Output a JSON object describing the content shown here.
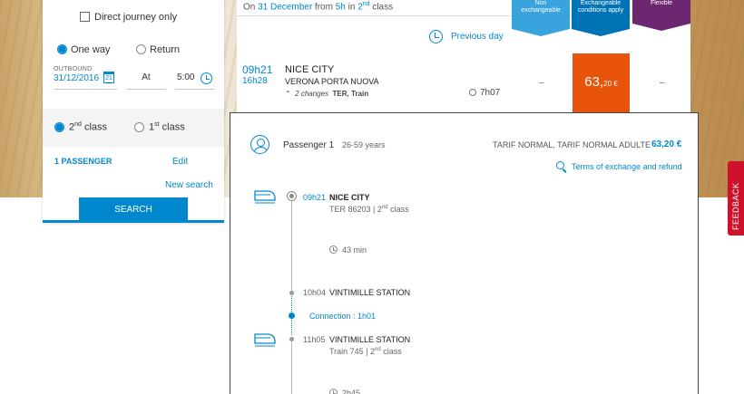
{
  "search": {
    "direct_journey": "Direct journey only",
    "one_way": "One way",
    "return": "Return",
    "outbound_label": "OUTBOUND",
    "outbound_date": "31/12/2016",
    "calendar_day": "21",
    "at_label": "At",
    "time_value": "5:00",
    "class2": "2",
    "class2_sup": "nd",
    "class2_suffix": " class",
    "class1": "1",
    "class1_sup": "st",
    "class1_suffix": " class",
    "passengers": "1 PASSENGER",
    "edit": "Edit",
    "new_search": "New search",
    "search_button": "SEARCH"
  },
  "results": {
    "header_prefix": "On ",
    "header_date": "31 December",
    "header_mid": " from ",
    "header_hour": "5h",
    "header_in": " in ",
    "header_class": "2",
    "header_class_sup": "nd",
    "header_suffix": " class",
    "fares": [
      {
        "line1": "Non",
        "line2": "exchangeable"
      },
      {
        "line1": "Exchangeable",
        "line2": "conditions apply"
      },
      {
        "line1": "Flexible",
        "line2": ""
      }
    ],
    "previous_day": "Previous day",
    "journey": {
      "dep_time": "09h21",
      "arr_time": "16h28",
      "dep_station": "NICE CITY",
      "arr_station": "VERONA PORTA NUOVA",
      "changes": "2 changes",
      "modes": "TER, Train",
      "duration": "7h07",
      "dash1": "–",
      "dash2": "–",
      "price_main": "63,",
      "price_cents": "20 €"
    }
  },
  "detail": {
    "passenger": "Passenger 1",
    "age": "26-59 years",
    "tariff": "TARIF NORMAL, TARIF NORMAL ADULTE",
    "tariff_price": "63,20 €",
    "terms": "Terms of exchange and refund",
    "segments": {
      "s1_time": "09h21",
      "s1_name": "NICE CITY",
      "s1_train": "TER 86203 | 2",
      "s1_sup": "nd",
      "s1_class": " class",
      "s1_duration": "43 min",
      "s2_time": "10h04",
      "s2_name": "VINTIMILLE STATION",
      "connection": "Connection : 1h01",
      "s3_time": "11h05",
      "s3_name": "VINTIMILLE STATION",
      "s3_train": "Train 745 | 2",
      "s3_sup": "nd",
      "s3_class": " class",
      "s3_duration": "2h45"
    }
  },
  "feedback": "FEEDBACK",
  "colors": {
    "accent": "#0088ce",
    "price": "#e8540c",
    "flexible": "#6c2770",
    "feedback": "#d0112b"
  }
}
